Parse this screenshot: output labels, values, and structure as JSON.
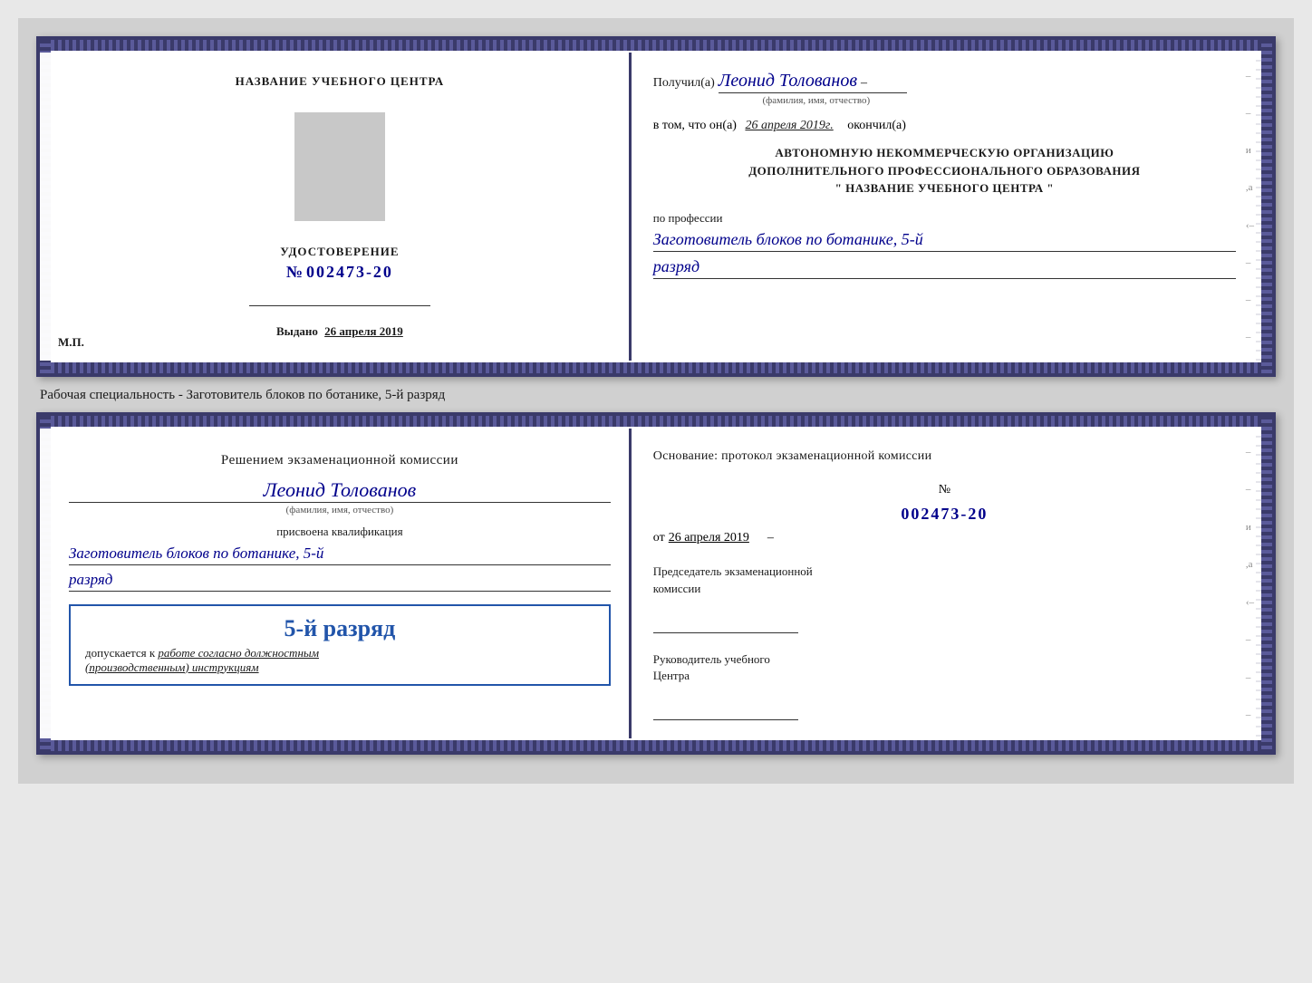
{
  "page": {
    "background": "#d0d0d0"
  },
  "card1": {
    "left": {
      "title": "НАЗВАНИЕ УЧЕБНОГО ЦЕНТРА",
      "cert_label": "УДОСТОВЕРЕНИЕ",
      "cert_no_prefix": "№",
      "cert_no": "002473-20",
      "issued_label": "Выдано",
      "issued_date": "26 апреля 2019",
      "mp_label": "М.П."
    },
    "right": {
      "received_prefix": "Получил(а)",
      "received_name": "Леонид Толованов",
      "fio_label": "(фамилия, имя, отчество)",
      "date_prefix": "в том, что он(а)",
      "date_value": "26 апреля 2019г.",
      "date_suffix": "окончил(а)",
      "org_line1": "АВТОНОМНУЮ НЕКОММЕРЧЕСКУЮ ОРГАНИЗАЦИЮ",
      "org_line2": "ДОПОЛНИТЕЛЬНОГО ПРОФЕССИОНАЛЬНОГО ОБРАЗОВАНИЯ",
      "org_line3": "\"   НАЗВАНИЕ УЧЕБНОГО ЦЕНТРА   \"",
      "profession_prefix": "по профессии",
      "profession_value": "Заготовитель блоков по ботанике, 5-й",
      "rank_value": "разряд"
    }
  },
  "specialty_label": "Рабочая специальность - Заготовитель блоков по ботанике, 5-й разряд",
  "card2": {
    "left": {
      "decision_text": "Решением экзаменационной комиссии",
      "name": "Леонид Толованов",
      "fio_label": "(фамилия, имя, отчество)",
      "assigned_label": "присвоена квалификация",
      "profession_value": "Заготовитель блоков по ботанике, 5-й",
      "rank_value": "разряд",
      "stamp_main": "5-й разряд",
      "stamp_sub_prefix": "допускается к",
      "stamp_sub_italic": "работе согласно должностным",
      "stamp_sub_end": "(производственным) инструкциям"
    },
    "right": {
      "basis_text": "Основание: протокол экзаменационной комиссии",
      "protocol_no_prefix": "№",
      "protocol_no": "002473-20",
      "from_prefix": "от",
      "from_date": "26 апреля 2019",
      "chairman_title_line1": "Председатель экзаменационной",
      "chairman_title_line2": "комиссии",
      "director_title_line1": "Руководитель учебного",
      "director_title_line2": "Центра"
    }
  }
}
